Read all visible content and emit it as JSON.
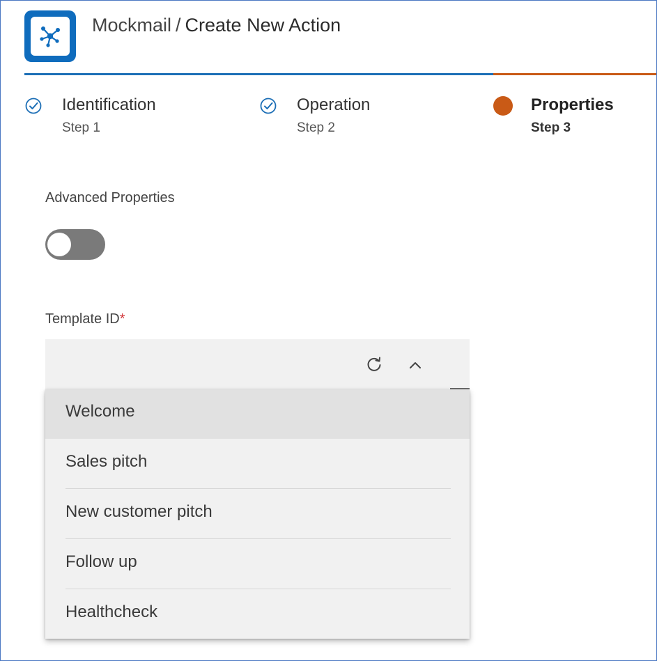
{
  "header": {
    "app_name": "Mockmail",
    "separator": "/",
    "page_title": "Create New Action",
    "app_icon": "network-hub-icon",
    "brand_color": "#0f6cbd"
  },
  "progress": {
    "completed_fraction": 0.74,
    "completed_color": "#1d6fb6",
    "remaining_color": "#c95a16"
  },
  "steps": [
    {
      "title": "Identification",
      "subtitle": "Step 1",
      "status": "completed",
      "icon": "check-circle-icon"
    },
    {
      "title": "Operation",
      "subtitle": "Step 2",
      "status": "completed",
      "icon": "check-circle-icon"
    },
    {
      "title": "Properties",
      "subtitle": "Step 3",
      "status": "active",
      "icon": "active-dot-icon"
    }
  ],
  "advanced": {
    "label": "Advanced Properties",
    "enabled": false
  },
  "template": {
    "label": "Template ID",
    "required_mark": "*",
    "value": "",
    "refresh_icon": "refresh-icon",
    "toggle_icon": "chevron-up-icon",
    "options": [
      {
        "label": "Welcome",
        "highlighted": true
      },
      {
        "label": "Sales pitch",
        "highlighted": false
      },
      {
        "label": "New customer pitch",
        "highlighted": false
      },
      {
        "label": "Follow up",
        "highlighted": false
      },
      {
        "label": "Healthcheck",
        "highlighted": false
      }
    ]
  }
}
